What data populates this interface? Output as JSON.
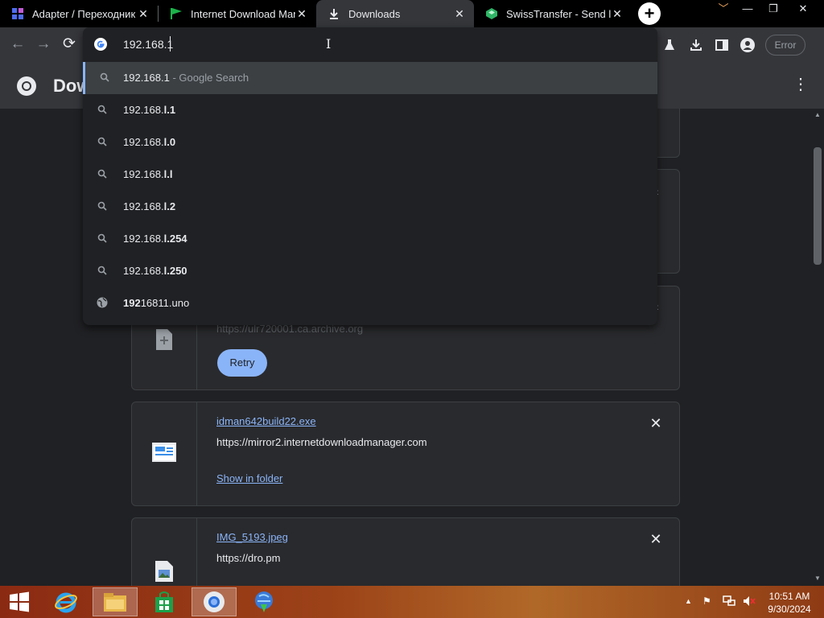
{
  "tabs": [
    {
      "title": "Adapter / Переходник",
      "icon": "grid-app-icon"
    },
    {
      "title": "Internet Download Man",
      "icon": "green-flag-icon"
    },
    {
      "title": "Downloads",
      "icon": "download-icon",
      "active": true
    },
    {
      "title": "SwissTransfer - Send lar",
      "icon": "swisstransfer-icon"
    }
  ],
  "toolbar": {
    "error_label": "Error"
  },
  "omnibox": {
    "query": "192.168.1",
    "suggestions": [
      {
        "prefix": "192.168.1",
        "suffix": "",
        "extra": " - Google Search",
        "type": "search"
      },
      {
        "prefix": "192.168.",
        "suffix": "l.1",
        "extra": "",
        "type": "search"
      },
      {
        "prefix": "192.168.",
        "suffix": "l.0",
        "extra": "",
        "type": "search"
      },
      {
        "prefix": "192.168.",
        "suffix": "l.l",
        "extra": "",
        "type": "search"
      },
      {
        "prefix": "192.168.",
        "suffix": "l.2",
        "extra": "",
        "type": "search"
      },
      {
        "prefix": "192.168.",
        "suffix": "l.254",
        "extra": "",
        "type": "search"
      },
      {
        "prefix": "192.168.",
        "suffix": "l.250",
        "extra": "",
        "type": "search"
      },
      {
        "prefix": "192",
        "suffix": "16811.uno",
        "extra": "",
        "type": "url"
      }
    ]
  },
  "page": {
    "title": "Dow"
  },
  "downloads": [
    {
      "partial_url": "https://ulr720001.ca.archive.org",
      "action": "Retry"
    },
    {
      "filename": "idman642build22.exe",
      "url": "https://mirror2.internetdownloadmanager.com",
      "action": "Show in folder"
    },
    {
      "filename": "IMG_5193.jpeg",
      "url": "https://dro.pm"
    }
  ],
  "taskbar": {
    "time": "10:51 AM",
    "date": "9/30/2024",
    "apps": [
      "start",
      "internet-explorer",
      "file-explorer",
      "store",
      "chrome",
      "idm"
    ]
  },
  "colors": {
    "accent": "#8ab4f8",
    "background": "#202124",
    "toolbar": "#35363a"
  }
}
